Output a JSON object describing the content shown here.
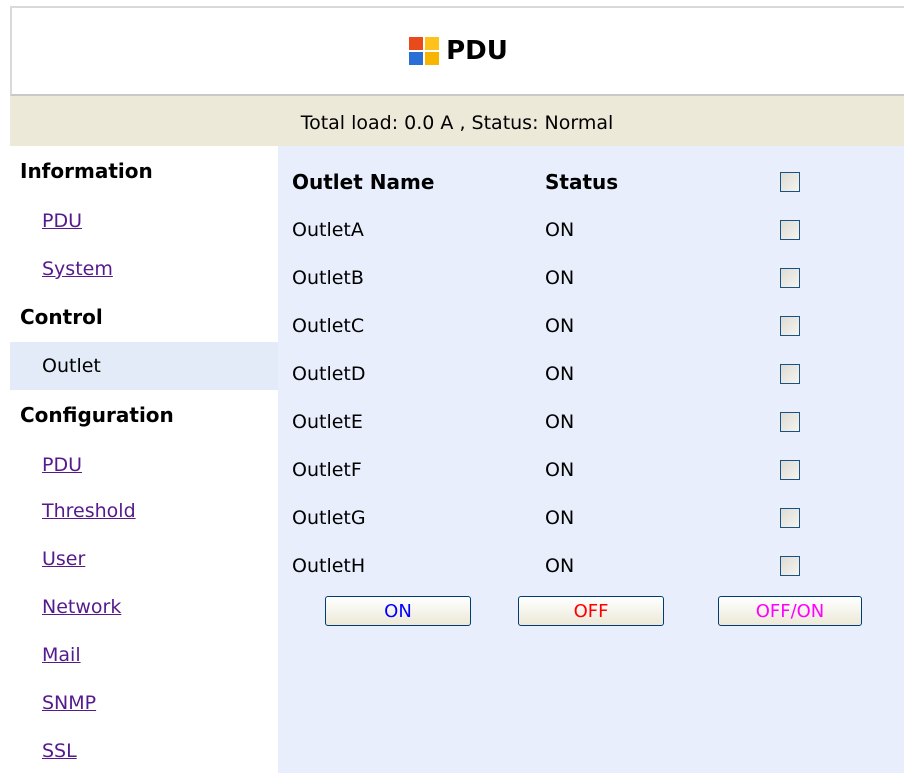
{
  "header": {
    "title": "PDU",
    "logo_icon": "windows-logo-icon"
  },
  "status": {
    "text": "Total load: 0.0 A , Status: Normal"
  },
  "sidebar": {
    "sections": [
      {
        "heading": "Information",
        "items": [
          "PDU",
          "System"
        ]
      },
      {
        "heading": "Control",
        "items": [
          "Outlet"
        ]
      },
      {
        "heading": "Configuration",
        "items": [
          "PDU",
          "Threshold",
          "User",
          "Network",
          "Mail",
          "SNMP",
          "SSL"
        ]
      }
    ],
    "active_item": "Outlet"
  },
  "table": {
    "headers": {
      "name": "Outlet Name",
      "status": "Status"
    },
    "rows": [
      {
        "name": "OutletA",
        "status": "ON",
        "checked": false
      },
      {
        "name": "OutletB",
        "status": "ON",
        "checked": false
      },
      {
        "name": "OutletC",
        "status": "ON",
        "checked": false
      },
      {
        "name": "OutletD",
        "status": "ON",
        "checked": false
      },
      {
        "name": "OutletE",
        "status": "ON",
        "checked": false
      },
      {
        "name": "OutletF",
        "status": "ON",
        "checked": false
      },
      {
        "name": "OutletG",
        "status": "ON",
        "checked": false
      },
      {
        "name": "OutletH",
        "status": "ON",
        "checked": false
      }
    ]
  },
  "buttons": {
    "on": {
      "label": "ON",
      "color": "#0000ff"
    },
    "off": {
      "label": "OFF",
      "color": "#ff0000"
    },
    "offon": {
      "label": "OFF/ON",
      "color": "#ff00ff"
    }
  }
}
